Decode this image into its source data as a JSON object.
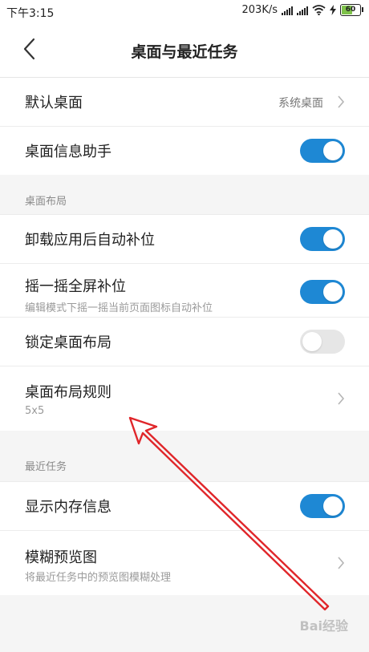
{
  "status_bar": {
    "time": "下午3:15",
    "speed": "203K/s",
    "battery": "60"
  },
  "header": {
    "title": "桌面与最近任务"
  },
  "section1": {
    "default_desktop": {
      "label": "默认桌面",
      "value": "系统桌面"
    },
    "info_assistant": {
      "label": "桌面信息助手",
      "enabled": true
    }
  },
  "layout_section": {
    "title": "桌面布局",
    "auto_fill": {
      "label": "卸载应用后自动补位",
      "enabled": true
    },
    "shake_fill": {
      "label": "摇一摇全屏补位",
      "subtitle": "编辑模式下摇一摇当前页面图标自动补位",
      "enabled": true
    },
    "lock_layout": {
      "label": "锁定桌面布局",
      "enabled": false
    },
    "layout_rule": {
      "label": "桌面布局规则",
      "subtitle": "5x5"
    }
  },
  "recent_section": {
    "title": "最近任务",
    "memory_info": {
      "label": "显示内存信息",
      "enabled": true
    },
    "blur_preview": {
      "label": "模糊预览图",
      "subtitle": "将最近任务中的预览图模糊处理"
    }
  },
  "colors": {
    "accent": "#1e88d4",
    "annotation_arrow": "#e0262a"
  },
  "watermark": "Bai经验"
}
